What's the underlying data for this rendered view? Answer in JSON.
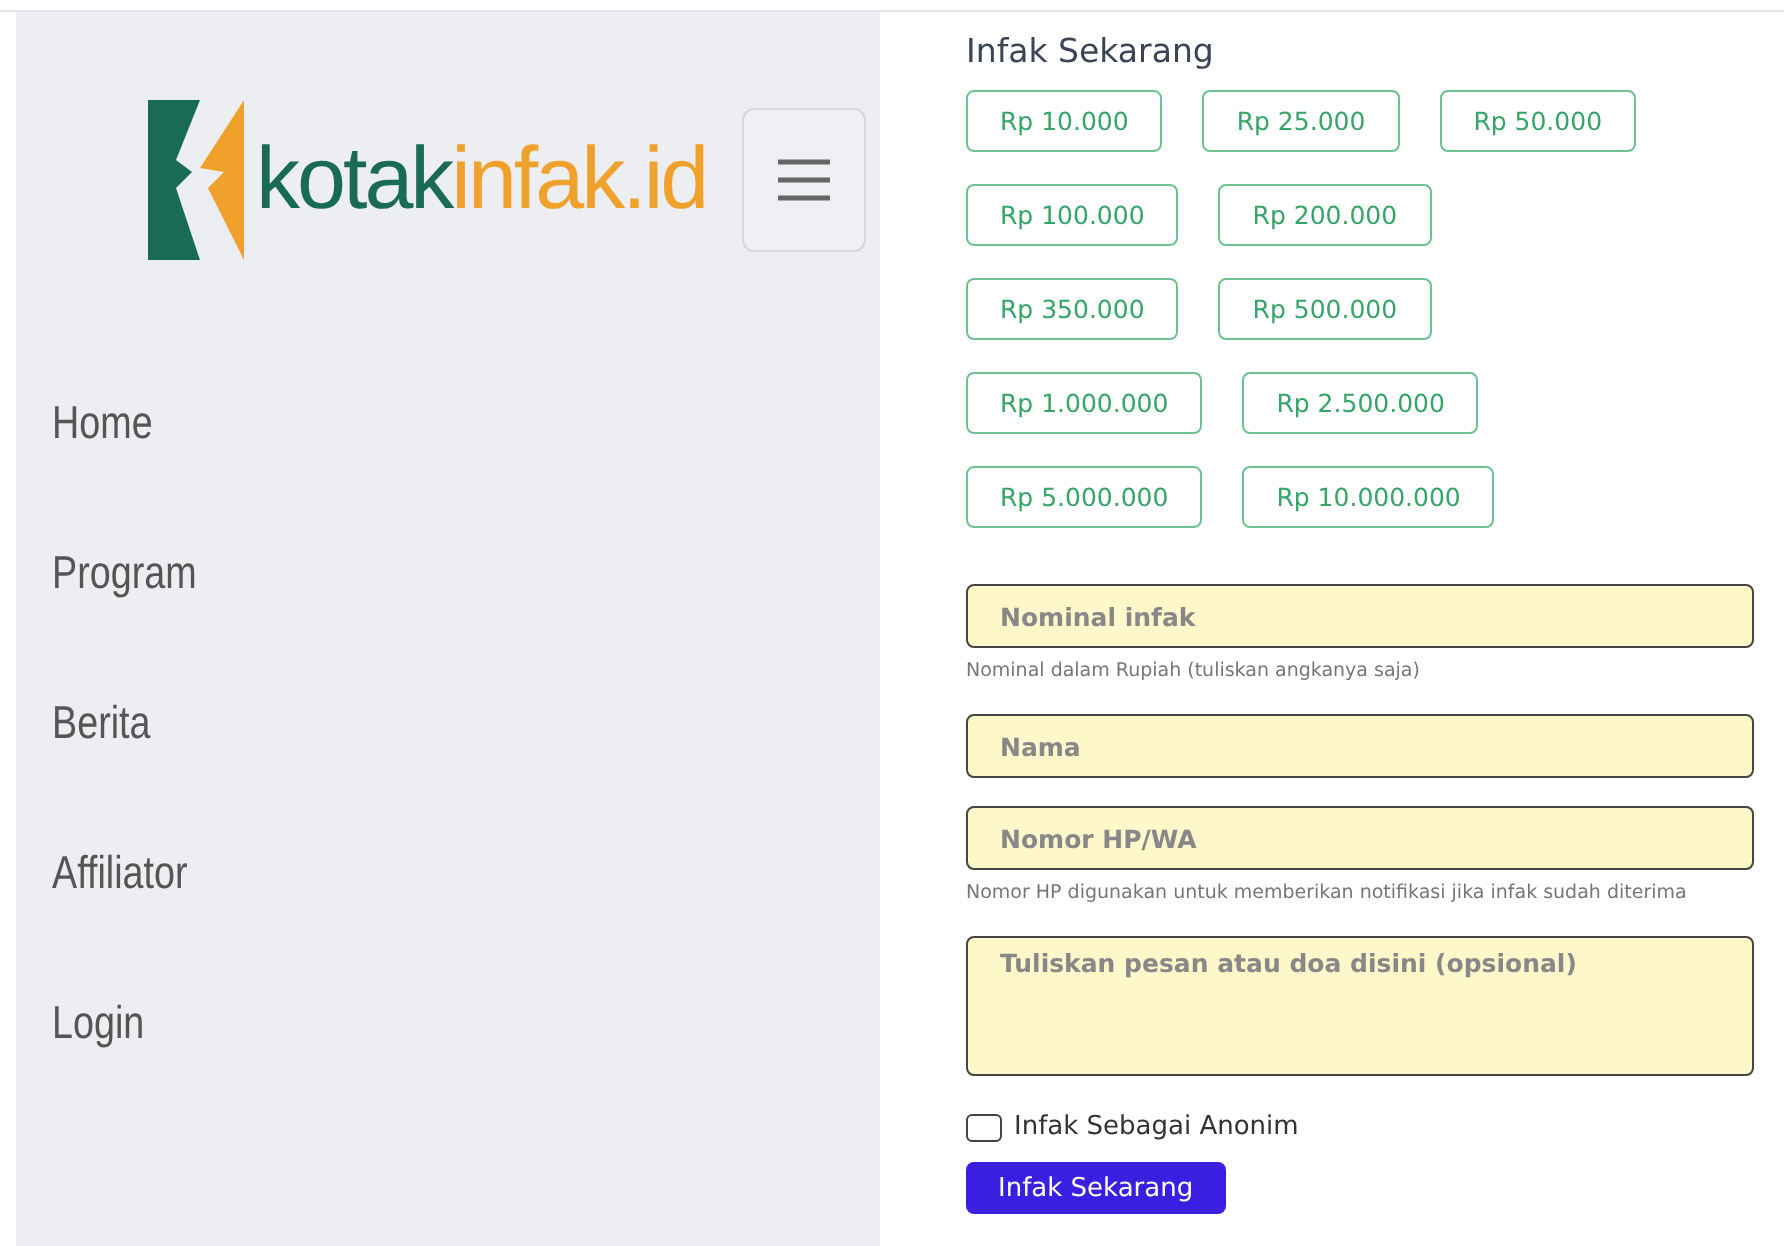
{
  "brand": {
    "part_1": "kotak",
    "part_2": "infak.id"
  },
  "nav": [
    {
      "label": "Home"
    },
    {
      "label": "Program"
    },
    {
      "label": "Berita"
    },
    {
      "label": "Affiliator"
    },
    {
      "label": "Login"
    }
  ],
  "form": {
    "title": "Infak Sekarang",
    "amount_rows": [
      [
        "Rp 10.000",
        "Rp 25.000",
        "Rp 50.000"
      ],
      [
        "Rp 100.000",
        "Rp 200.000"
      ],
      [
        "Rp 350.000",
        "Rp 500.000"
      ],
      [
        "Rp 1.000.000",
        "Rp 2.500.000"
      ],
      [
        "Rp 5.000.000",
        "Rp 10.000.000"
      ]
    ],
    "fields": [
      {
        "kind": "input",
        "placeholder": "Nominal infak",
        "help": "Nominal dalam Rupiah (tuliskan angkanya saja)"
      },
      {
        "kind": "input",
        "placeholder": "Nama"
      },
      {
        "kind": "input",
        "placeholder": "Nomor HP/WA",
        "help": "Nomor HP digunakan untuk memberikan notifikasi jika infak sudah diterima"
      },
      {
        "kind": "textarea",
        "placeholder": "Tuliskan pesan atau doa disini (opsional)"
      }
    ],
    "anonymous": {
      "label": "Infak Sebagai Anonim",
      "checked": false
    },
    "submit": "Infak Sekarang"
  }
}
